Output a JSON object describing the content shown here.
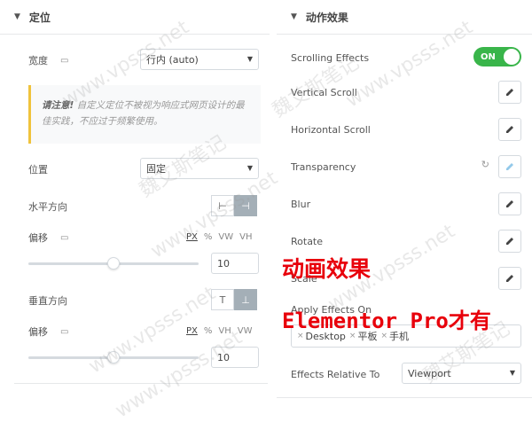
{
  "left": {
    "section_title": "定位",
    "width_label": "宽度",
    "width_value": "行内 (auto)",
    "notice_bold": "请注意!",
    "notice_text": "自定义定位不被视为响应式网页设计的最佳实践，不应过于频繁使用。",
    "position_label": "位置",
    "position_value": "固定",
    "horizontal_label": "水平方向",
    "offset_label": "偏移",
    "h_units": [
      "PX",
      "%",
      "VW",
      "VH"
    ],
    "h_value": "10",
    "vertical_label": "垂直方向",
    "v_units": [
      "PX",
      "%",
      "VH",
      "VW"
    ],
    "v_value": "10",
    "icon_left": "⊢",
    "icon_right": "⊣",
    "icon_top": "T",
    "icon_bottom": "⊥",
    "h_slider_fraction": 0.5,
    "v_slider_fraction": 0.5
  },
  "right": {
    "section_title": "动作效果",
    "scrolling_effects_label": "Scrolling Effects",
    "toggle_label": "ON",
    "effects": [
      "Vertical Scroll",
      "Horizontal Scroll",
      "Transparency",
      "Blur",
      "Rotate",
      "Scale"
    ],
    "apply_on_label": "Apply Effects On",
    "apply_on_tags": [
      "Desktop",
      "平板",
      "手机"
    ],
    "relative_label": "Effects Relative To",
    "relative_value": "Viewport"
  },
  "overlay": {
    "line1": "动画效果",
    "line2": "Elementor Pro才有"
  },
  "watermark": {
    "site": "www.vpsss.net",
    "name": "魏艾斯笔记"
  },
  "colors": {
    "toggle_on": "#39b54a",
    "notice_border": "#f0c33c",
    "overlay_red": "#e8000b",
    "active_edit": "#93c9ea"
  }
}
